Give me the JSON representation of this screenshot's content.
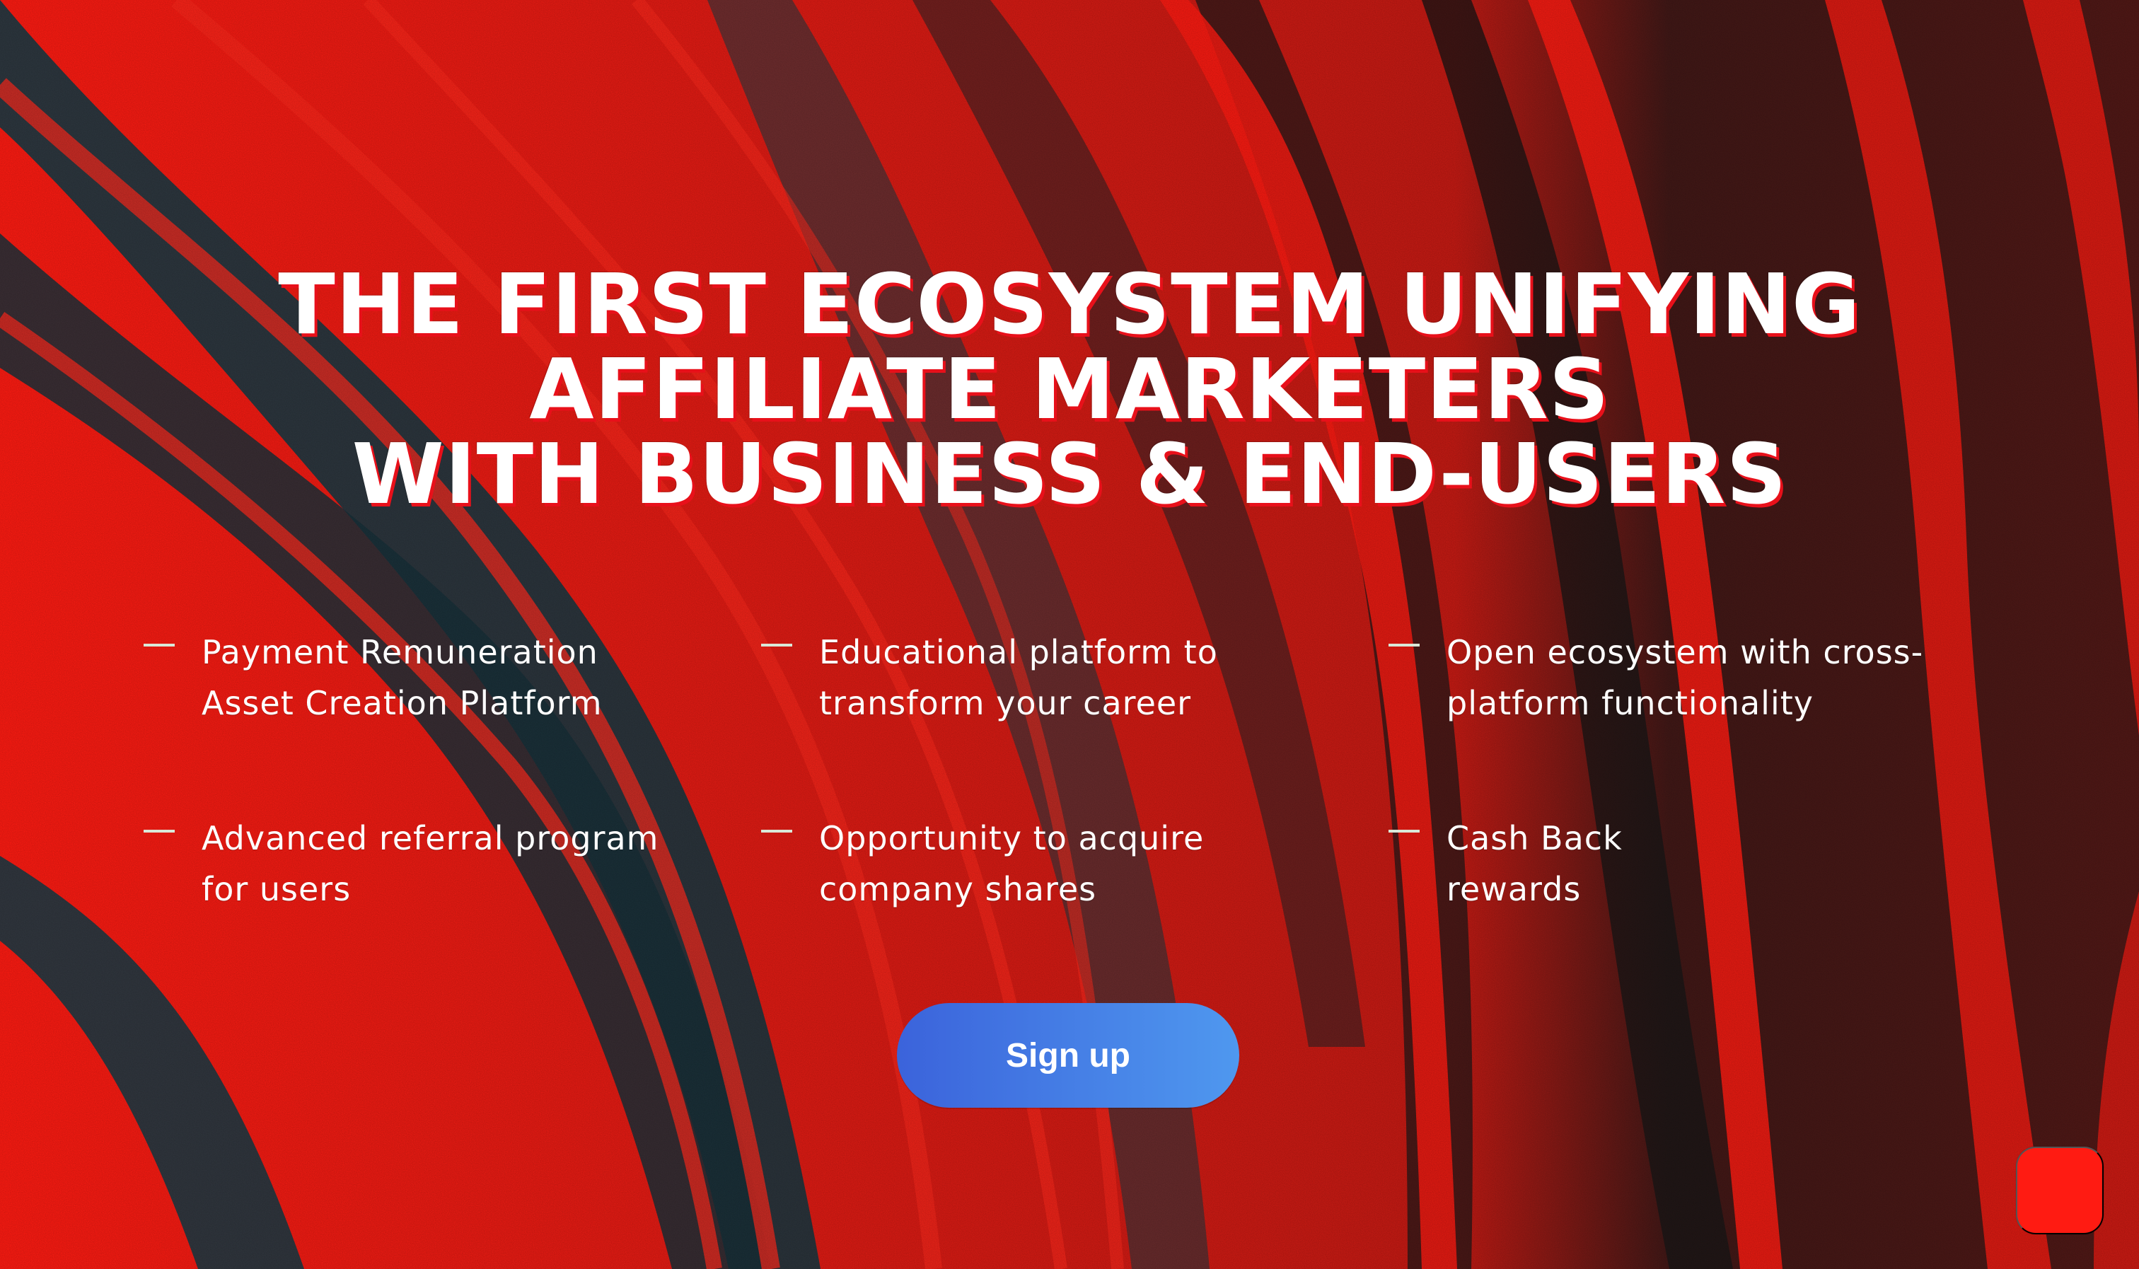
{
  "hero": {
    "line1": "THE FIRST ECOSYSTEM UNIFYING",
    "line2": "AFFILIATE MARKETERS",
    "line3": "WITH BUSINESS & END-USERS"
  },
  "features": [
    {
      "line1": "Payment Remuneration",
      "line2": "Asset Creation Platform"
    },
    {
      "line1": "Educational platform to",
      "line2": "transform your career"
    },
    {
      "line1": "Open ecosystem with cross-",
      "line2": "platform functionality"
    },
    {
      "line1": "Advanced referral program",
      "line2": "for users"
    },
    {
      "line1": "Opportunity to acquire",
      "line2": "company shares"
    },
    {
      "line1": "Cash Back",
      "line2": "rewards"
    }
  ],
  "cta": {
    "label": "Sign up"
  },
  "chat_widget": {
    "icon": "chat-icon"
  },
  "colors": {
    "background_red": "#ff1b12",
    "background_dark": "#181818",
    "button_start": "#3b63db",
    "button_end": "#4f98ef",
    "text": "#ffffff"
  }
}
